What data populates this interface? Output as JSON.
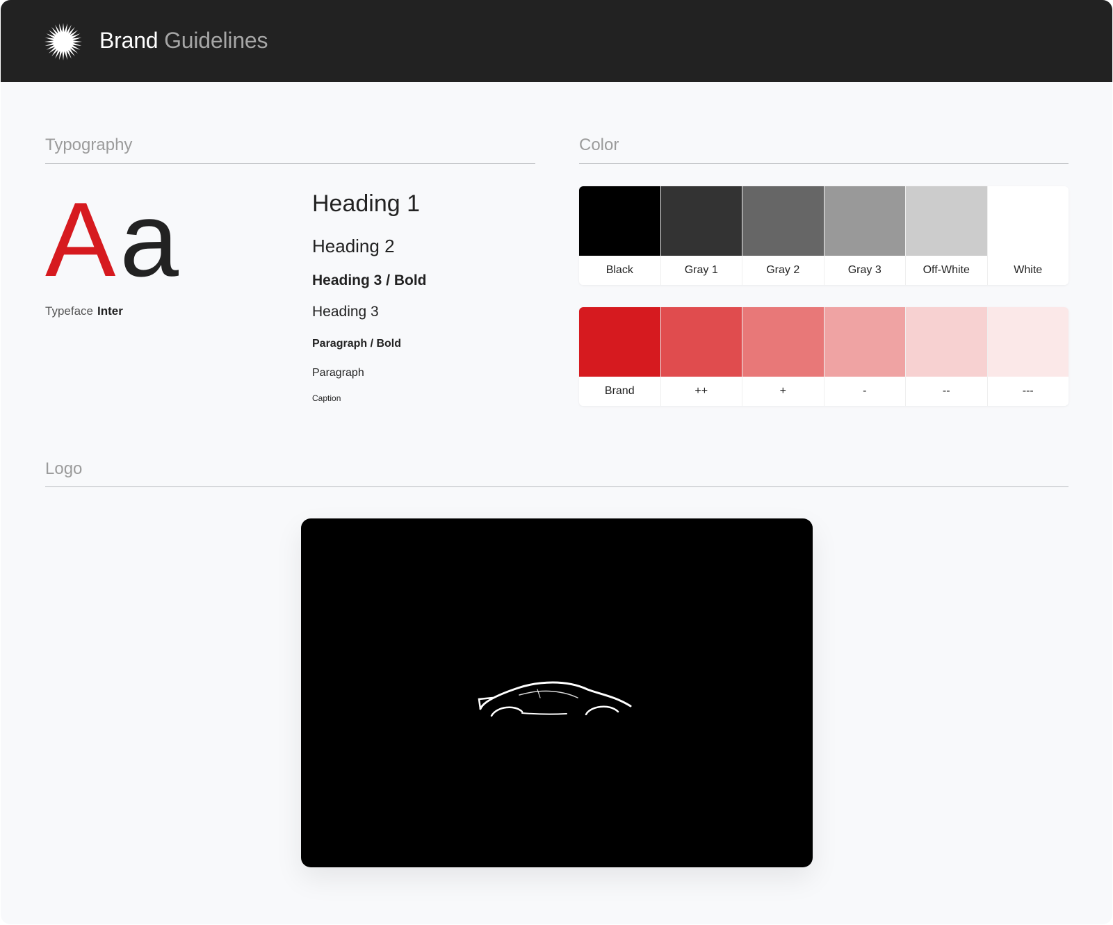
{
  "header": {
    "title_primary": "Brand",
    "title_secondary": "Guidelines",
    "logo_icon": "starburst-icon"
  },
  "typography": {
    "section_title": "Typography",
    "sample_upper": "A",
    "sample_lower": "a",
    "typeface_label": "Typeface",
    "typeface_name": "Inter",
    "styles": [
      "Heading 1",
      "Heading 2",
      "Heading 3 / Bold",
      "Heading 3",
      "Paragraph / Bold",
      "Paragraph",
      "Caption"
    ]
  },
  "color": {
    "section_title": "Color",
    "neutrals": [
      {
        "label": "Black",
        "hex": "#000000"
      },
      {
        "label": "Gray 1",
        "hex": "#333333"
      },
      {
        "label": "Gray 2",
        "hex": "#666666"
      },
      {
        "label": "Gray 3",
        "hex": "#999999"
      },
      {
        "label": "Off-White",
        "hex": "#cccccc"
      },
      {
        "label": "White",
        "hex": "#ffffff"
      }
    ],
    "brand": [
      {
        "label": "Brand",
        "hex": "#d61a1f"
      },
      {
        "label": "++",
        "hex": "#e04c4e"
      },
      {
        "label": "+",
        "hex": "#e87878"
      },
      {
        "label": "-",
        "hex": "#efa3a3"
      },
      {
        "label": "--",
        "hex": "#f7d1d1"
      },
      {
        "label": "---",
        "hex": "#fbe8e8"
      }
    ]
  },
  "logo": {
    "section_title": "Logo",
    "image_icon": "car-silhouette-icon"
  }
}
